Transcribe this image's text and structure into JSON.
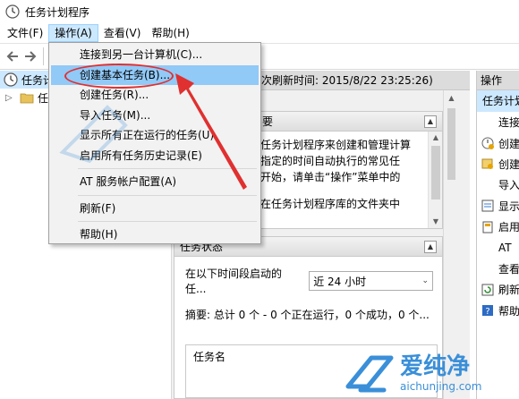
{
  "window": {
    "title": "任务计划程序"
  },
  "menubar": {
    "items": [
      {
        "label": "文件(F)"
      },
      {
        "label": "操作(A)"
      },
      {
        "label": "查看(V)"
      },
      {
        "label": "帮助(H)"
      }
    ]
  },
  "dropdown": {
    "items": [
      {
        "label": "连接到另一台计算机(C)..."
      },
      {
        "label": "创建基本任务(B)..."
      },
      {
        "label": "创建任务(R)..."
      },
      {
        "label": "导入任务(M)..."
      },
      {
        "label": "显示所有正在运行的任务(U)"
      },
      {
        "label": "启用所有任务历史记录(E)"
      },
      {
        "label": "AT 服务帐户配置(A)"
      },
      {
        "label": "刷新(F)"
      },
      {
        "label": "帮助(H)"
      }
    ]
  },
  "tree": {
    "items": [
      {
        "label": "任务计划"
      },
      {
        "label": "任"
      }
    ]
  },
  "center": {
    "header": "次刷新时间: 2015/8/22 23:25:26)",
    "overview_panel": {
      "head": "要",
      "lines": [
        "任务计划程序来创建和管理计算",
        "指定的时间自动执行的常见任",
        "开始，请单击“操作”菜单中的",
        "在任务计划程序库的文件夹中"
      ]
    },
    "status_panel": {
      "head": "任务状态",
      "period_label": "在以下时间段启动的任...",
      "period_value": "近 24 小时",
      "summary": "摘要: 总计 0 个 - 0 个正在运行，0 个成功，0 个..."
    },
    "task_table": {
      "column": "任务名"
    }
  },
  "actions": {
    "header": "操作",
    "section": "任务计划",
    "items": [
      {
        "label": "连接",
        "icon": "none"
      },
      {
        "label": "创建",
        "icon": "create-basic-task-icon"
      },
      {
        "label": "创建",
        "icon": "create-task-icon"
      },
      {
        "label": "导入",
        "icon": "none"
      },
      {
        "label": "显示",
        "icon": "running-tasks-icon"
      },
      {
        "label": "启用",
        "icon": "history-icon"
      },
      {
        "label": "AT",
        "icon": "none"
      },
      {
        "label": "查看",
        "icon": "none"
      },
      {
        "label": "刷新",
        "icon": "refresh-icon"
      },
      {
        "label": "帮助",
        "icon": "help-icon"
      }
    ]
  },
  "watermark": {
    "brand": "爱纯净",
    "url": "aichunjing.com"
  },
  "colors": {
    "menu_highlight": "#91c9f7",
    "annotation_red": "#e03030",
    "selection": "#cce8ff",
    "watermark_blue": "#3a8fd8"
  }
}
